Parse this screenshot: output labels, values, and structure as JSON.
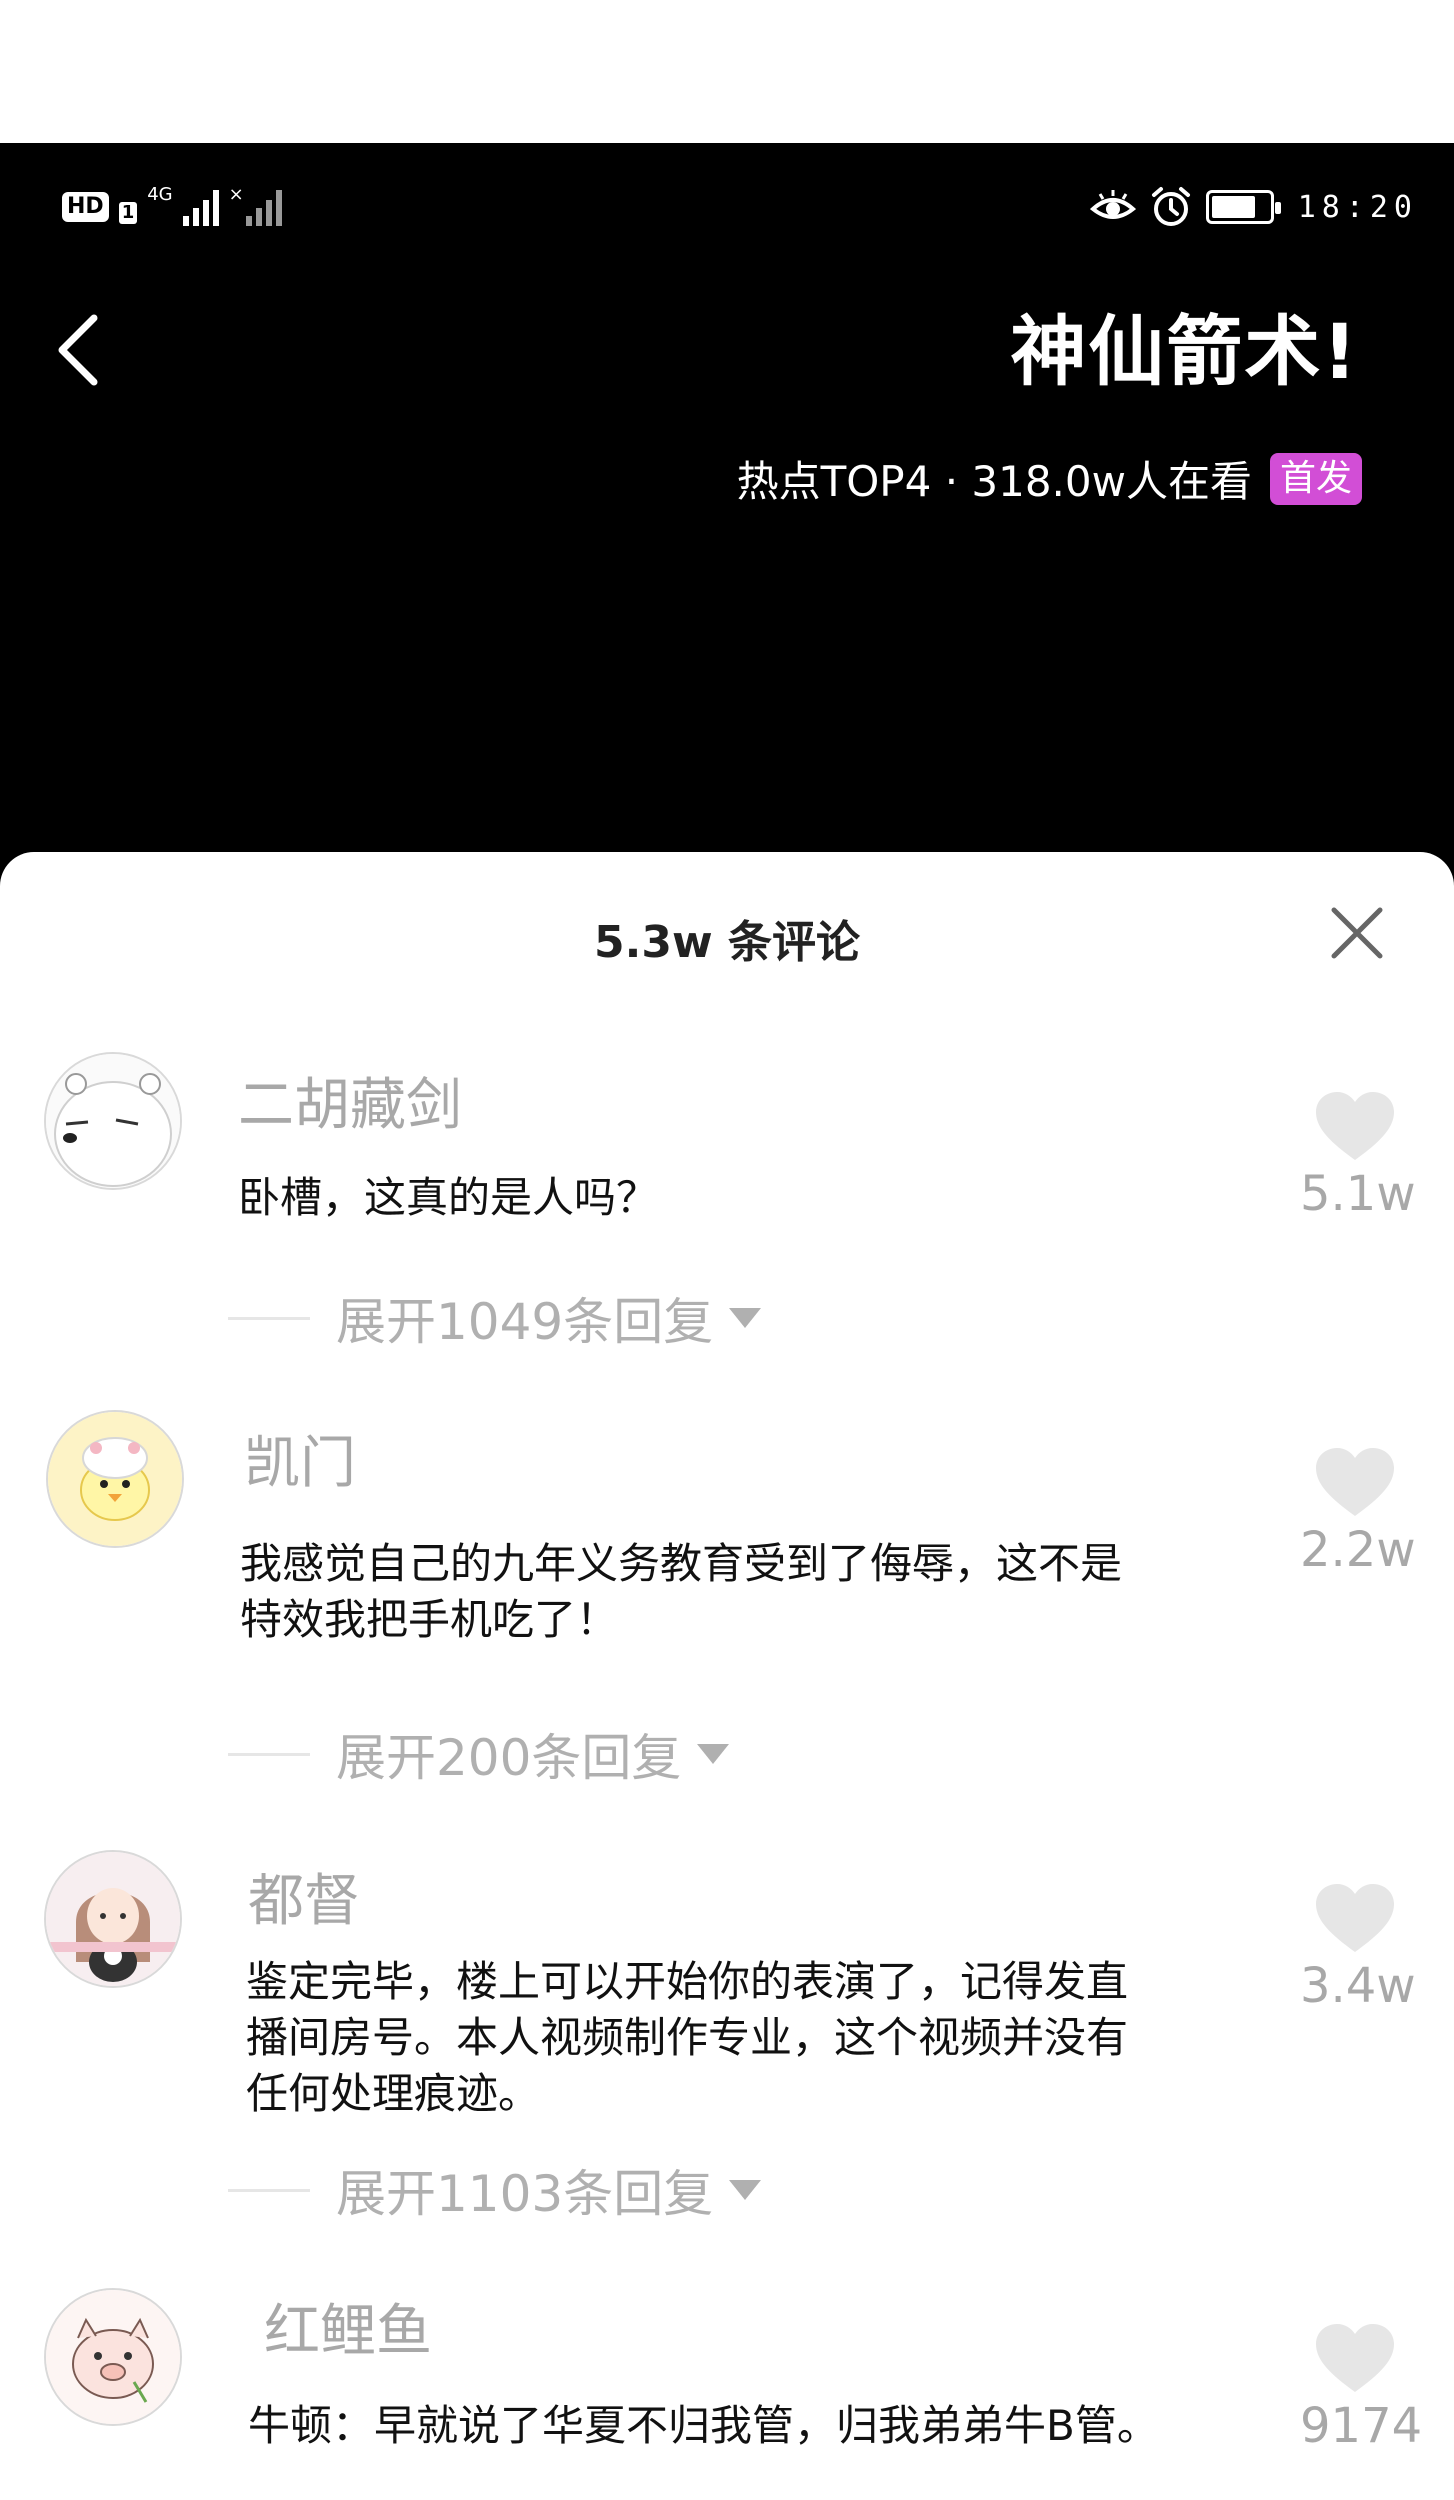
{
  "status_bar": {
    "hd": "HD",
    "sim_index": "1",
    "network": "4G",
    "time": "18:20"
  },
  "video": {
    "title": "神仙箭术!",
    "hot_text": "热点TOP4 · 318.0w人在看",
    "badge": "首发",
    "badge_color": "#d24ed6"
  },
  "comments_panel": {
    "title": "5.3w 条评论",
    "comments": [
      {
        "username": "二胡藏剑",
        "text": "卧槽，这真的是人吗？",
        "likes": "5.1w",
        "replies": "展开1049条回复",
        "avatar_icon": "polar-bear-avatar-icon"
      },
      {
        "username": "凯门",
        "text": "我感觉自己的九年义务教育受到了侮辱，这不是特效我把手机吃了！",
        "likes": "2.2w",
        "replies": "展开200条回复",
        "avatar_icon": "chick-avatar-icon"
      },
      {
        "username": "都督",
        "text": "鉴定完毕，楼上可以开始你的表演了，记得发直播间房号。本人视频制作专业，这个视频并没有任何处理痕迹。",
        "likes": "3.4w",
        "replies": "展开1103条回复",
        "avatar_icon": "girl-avatar-icon"
      },
      {
        "username": "红鲤鱼",
        "text": "牛顿：早就说了华夏不归我管，归我弟弟牛B管。",
        "likes": "9174",
        "avatar_icon": "pig-avatar-icon"
      }
    ]
  }
}
